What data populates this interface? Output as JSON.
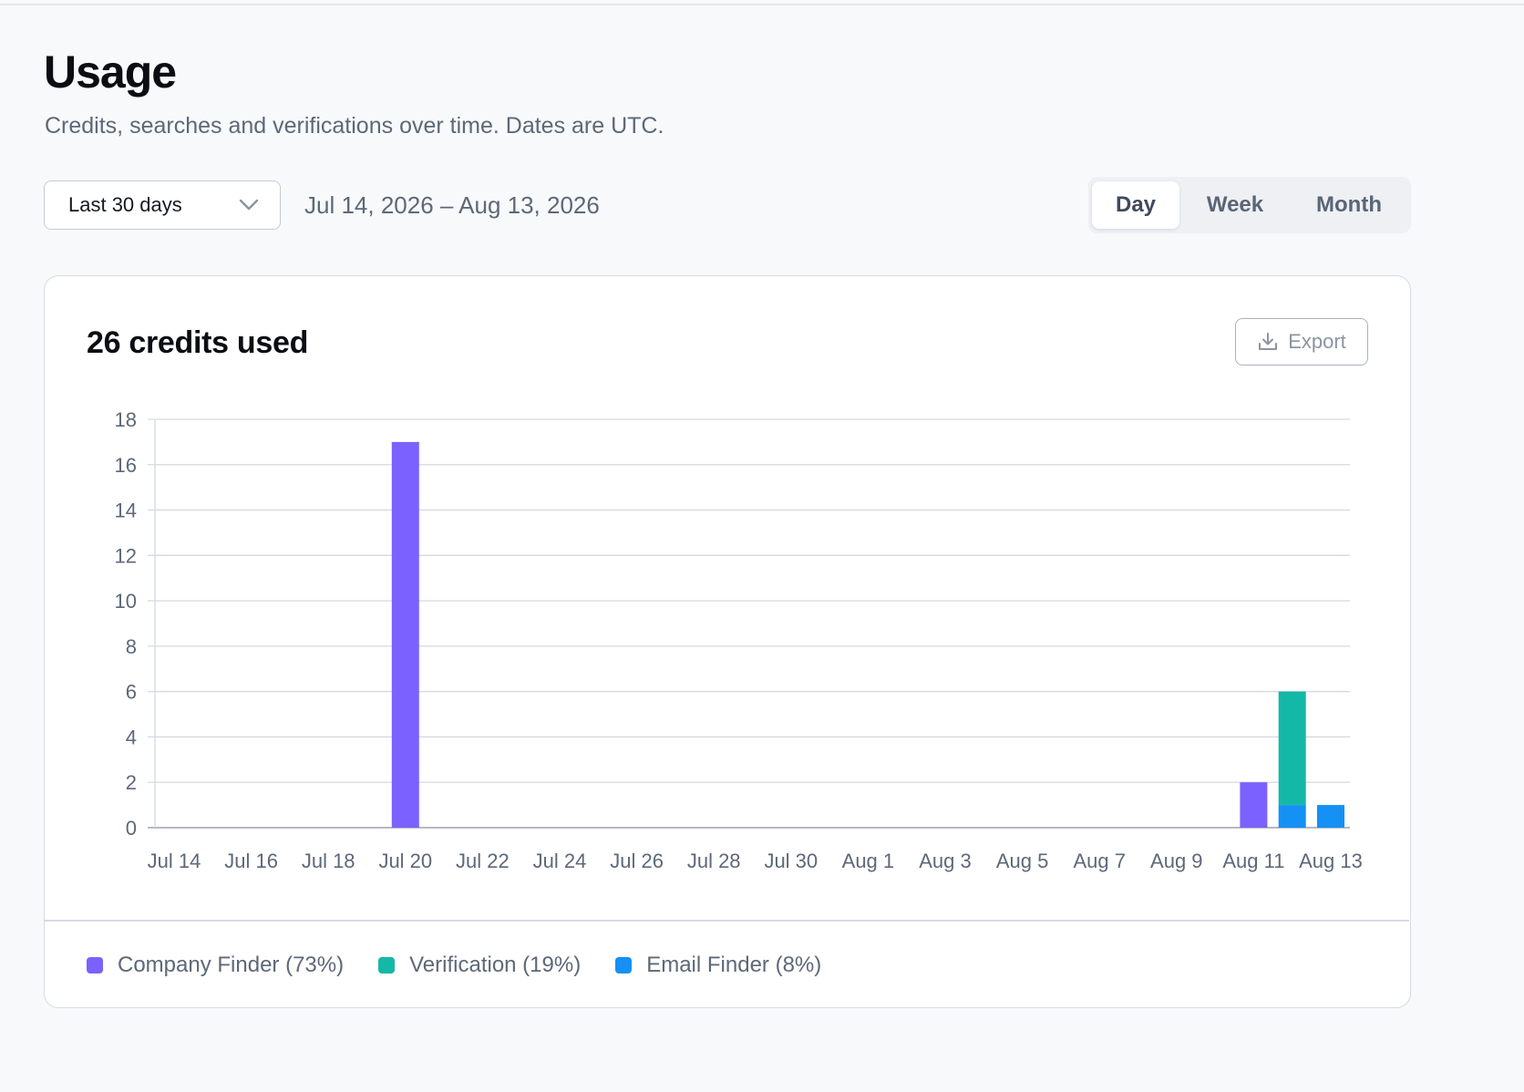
{
  "page": {
    "title": "Usage",
    "subtitle": "Credits, searches and verifications over time. Dates are UTC."
  },
  "controls": {
    "range_select": {
      "value": "Last 30 days",
      "icon": "chevron-down-icon"
    },
    "date_range": "Jul 14, 2026 – Aug 13, 2026",
    "granularity": {
      "options": [
        "Day",
        "Week",
        "Month"
      ],
      "selected": "Day"
    }
  },
  "card": {
    "title": "26 credits used",
    "export_label": "Export",
    "export_icon": "download-icon"
  },
  "legend": {
    "items": [
      {
        "label": "Company Finder (73%)",
        "color": "#7b61ff"
      },
      {
        "label": "Verification (19%)",
        "color": "#14b8a6"
      },
      {
        "label": "Email Finder (8%)",
        "color": "#1590f5"
      }
    ]
  },
  "chart_data": {
    "type": "bar",
    "stacked": true,
    "x": [
      "Jul 14",
      "Jul 15",
      "Jul 16",
      "Jul 17",
      "Jul 18",
      "Jul 19",
      "Jul 20",
      "Jul 21",
      "Jul 22",
      "Jul 23",
      "Jul 24",
      "Jul 25",
      "Jul 26",
      "Jul 27",
      "Jul 28",
      "Jul 29",
      "Jul 30",
      "Jul 31",
      "Aug 1",
      "Aug 2",
      "Aug 3",
      "Aug 4",
      "Aug 5",
      "Aug 6",
      "Aug 7",
      "Aug 8",
      "Aug 9",
      "Aug 10",
      "Aug 11",
      "Aug 12",
      "Aug 13"
    ],
    "xticks": [
      "Jul 14",
      "Jul 16",
      "Jul 18",
      "Jul 20",
      "Jul 22",
      "Jul 24",
      "Jul 26",
      "Jul 28",
      "Jul 30",
      "Aug 1",
      "Aug 3",
      "Aug 5",
      "Aug 7",
      "Aug 9",
      "Aug 11",
      "Aug 13"
    ],
    "yticks": [
      0,
      2,
      4,
      6,
      8,
      10,
      12,
      14,
      16,
      18
    ],
    "ylim": [
      0,
      18
    ],
    "grid": true,
    "legend_position": "bottom-left",
    "series": [
      {
        "name": "Company Finder",
        "color": "#7b61ff",
        "values": [
          0,
          0,
          0,
          0,
          0,
          0,
          17,
          0,
          0,
          0,
          0,
          0,
          0,
          0,
          0,
          0,
          0,
          0,
          0,
          0,
          0,
          0,
          0,
          0,
          0,
          0,
          0,
          0,
          2,
          0,
          0
        ]
      },
      {
        "name": "Email Finder",
        "color": "#1590f5",
        "values": [
          0,
          0,
          0,
          0,
          0,
          0,
          0,
          0,
          0,
          0,
          0,
          0,
          0,
          0,
          0,
          0,
          0,
          0,
          0,
          0,
          0,
          0,
          0,
          0,
          0,
          0,
          0,
          0,
          0,
          1,
          1
        ]
      },
      {
        "name": "Verification",
        "color": "#14b8a6",
        "values": [
          0,
          0,
          0,
          0,
          0,
          0,
          0,
          0,
          0,
          0,
          0,
          0,
          0,
          0,
          0,
          0,
          0,
          0,
          0,
          0,
          0,
          0,
          0,
          0,
          0,
          0,
          0,
          0,
          0,
          5,
          0
        ]
      }
    ]
  }
}
